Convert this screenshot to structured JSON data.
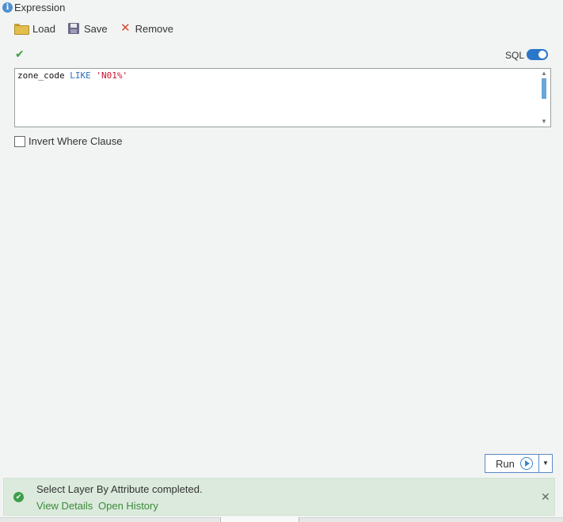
{
  "header": {
    "title": "Expression"
  },
  "toolbar": {
    "load_label": "Load",
    "save_label": "Save",
    "remove_label": "Remove"
  },
  "sql_toggle": {
    "label": "SQL",
    "on": true
  },
  "editor": {
    "field": "zone_code",
    "operator": "LIKE",
    "value": "'N01%'"
  },
  "options": {
    "invert_label": "Invert Where Clause",
    "invert_checked": false
  },
  "run": {
    "label": "Run"
  },
  "status": {
    "message": "Select Layer By Attribute completed.",
    "view_details": "View Details",
    "open_history": "Open History"
  },
  "colors": {
    "accent": "#2a76c9",
    "success": "#3e9e4a",
    "status_bg": "#dbeadc",
    "keyword": "#2f6fc0",
    "string": "#c8102e"
  },
  "icons": {
    "info": "info-icon",
    "load": "folder-icon",
    "save": "disk-icon",
    "remove": "close-x-icon",
    "valid": "checkmark-icon",
    "run": "play-circle-icon",
    "status": "success-check-icon",
    "dismiss": "close-icon"
  }
}
